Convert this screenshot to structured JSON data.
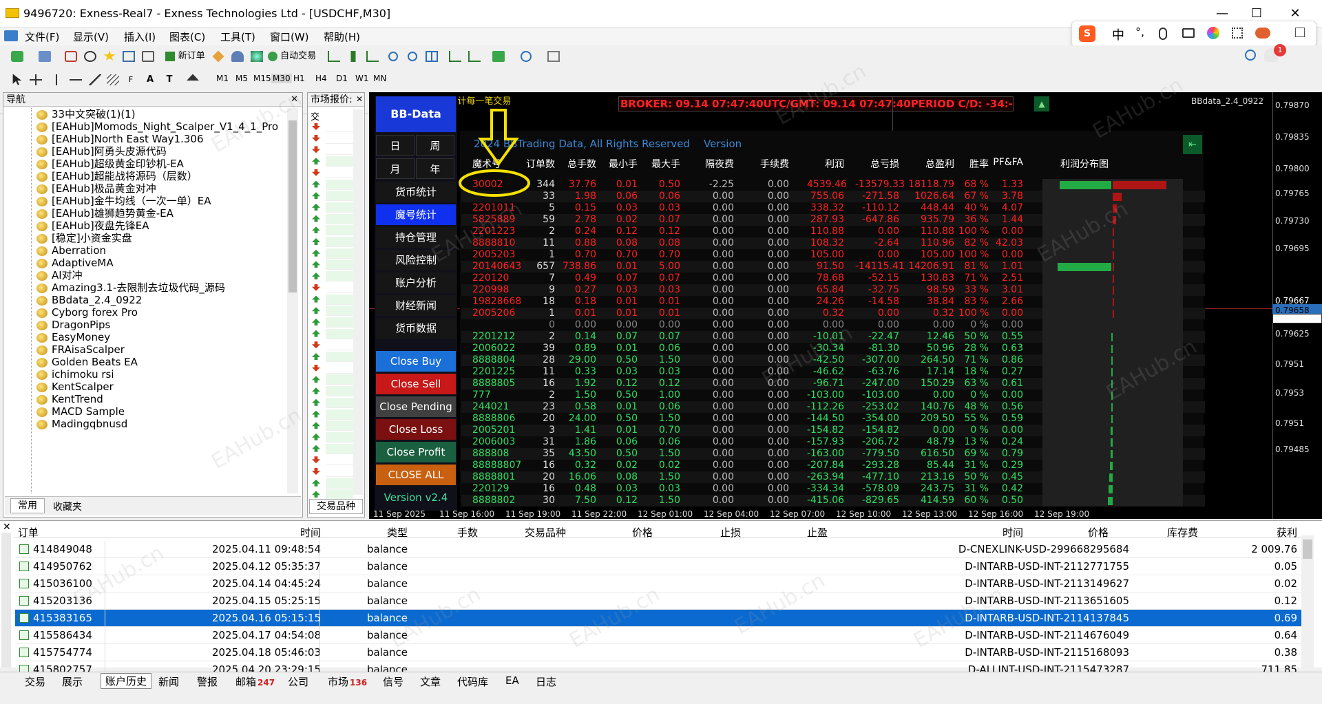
{
  "window": {
    "title": "9496720: Exness-Real7 - Exness Technologies Ltd - [USDCHF,M30]",
    "min": "—",
    "max": "☐",
    "close": "✕"
  },
  "menu": [
    "文件(F)",
    "显示(V)",
    "插入(I)",
    "图表(C)",
    "工具(T)",
    "窗口(W)",
    "帮助(H)"
  ],
  "ime": {
    "label_zh": "中",
    "punct": "°,"
  },
  "toolbar": {
    "new_order": "新订单",
    "auto_trade": "自动交易",
    "timeframes": [
      "M1",
      "M5",
      "M15",
      "M30",
      "H1",
      "H4",
      "D1",
      "W1",
      "MN"
    ]
  },
  "navigator": {
    "title": "导航",
    "items": [
      "33中文突破(1)(1)",
      "[EAHub]Momods_Night_Scalper_V1_4_1_Pro",
      "[EAHub]North East Way1.306",
      "[EAHub]阿勇头皮源代码",
      "[EAHub]超级黄金印钞机-EA",
      "[EAHub]超能战将源码（层数）",
      "[EAHub]极品黄金对冲",
      "[EAHub]金牛均线（一次一单）EA",
      "[EAHub]雄狮趋势黄金-EA",
      "[EAHub]夜盘先锋EA",
      "[稳定]小资金实盘",
      "Aberration",
      "AdaptiveMA",
      "AI对冲",
      "Amazing3.1-去限制去垃圾代码_源码",
      "BBdata_2.4_0922",
      "Cyborg forex  Pro",
      "DragonPips",
      "EasyMoney",
      "FRAisaScalper",
      "Golden Beats EA",
      "ichimoku rsi",
      "KentScalper",
      "KentTrend",
      "MACD Sample",
      "Madingqbnusd"
    ],
    "tab_common": "常用",
    "tab_fav": "收藏夹"
  },
  "market": {
    "title": "市场报价:",
    "col": "交",
    "tab": "交易品种"
  },
  "chart": {
    "symbol_label": "BBdata_2.4_0922",
    "annotation": "MT4统计每一笔交易",
    "ticker": "BROKER: 09.14 07:47:40UTC/GMT: 09.14 07:47:40PERIOD C/D: -34:-47:-40",
    "copyright": "2024 BBTrading Data, All Rights Reserved",
    "version_label": "Version",
    "prices": [
      "0.79870",
      "0.79835",
      "0.79800",
      "0.79765",
      "0.79730",
      "0.79695",
      "0.79667",
      "0.79658",
      "0.79625",
      "0.7951",
      "0.7953",
      "0.7951",
      "0.79485"
    ],
    "times": [
      "11 Sep 2025",
      "11 Sep 16:00",
      "11 Sep 19:00",
      "11 Sep 22:00",
      "12 Sep 01:00",
      "12 Sep 04:00",
      "12 Sep 07:00",
      "12 Sep 10:00",
      "12 Sep 13:00",
      "12 Sep 16:00",
      "12 Sep 19:00"
    ]
  },
  "bb": {
    "logo": "BB-Data",
    "day": "日",
    "week": "周",
    "month": "月",
    "year": "年",
    "currency": "货币统计",
    "magic": "魔号统计",
    "position": "持仓管理",
    "risk": "风险控制",
    "account": "账户分析",
    "news": "财经新闻",
    "data": "货币数据",
    "close_buy": "Close Buy",
    "close_sell": "Close Sell",
    "close_pending": "Close Pending",
    "close_loss": "Close Loss",
    "close_profit": "Close Profit",
    "close_all": "CLOSE ALL",
    "version": "Version v2.4"
  },
  "stats": {
    "headers": [
      "魔术号",
      "订单数",
      "总手数",
      "最小手",
      "最大手",
      "隔夜费",
      "手续费",
      "利润",
      "总亏损",
      "总盈利",
      "胜率",
      "PF&FA",
      "利润分布图"
    ],
    "rows": [
      [
        "30002",
        "344",
        "37.76",
        "0.01",
        "0.50",
        "-2.25",
        "0.00",
        "4539.46",
        "-13579.33",
        "18118.79",
        "68 %",
        "1.33",
        "r"
      ],
      [
        "",
        "33",
        "1.98",
        "0.06",
        "0.06",
        "0.00",
        "0.00",
        "755.06",
        "-271.58",
        "1026.64",
        "67 %",
        "3.78",
        "r"
      ],
      [
        "2201011",
        "5",
        "0.15",
        "0.03",
        "0.03",
        "0.00",
        "0.00",
        "338.32",
        "-110.12",
        "448.44",
        "40 %",
        "4.07",
        "r"
      ],
      [
        "5825889",
        "59",
        "2.78",
        "0.02",
        "0.07",
        "0.00",
        "0.00",
        "287.93",
        "-647.86",
        "935.79",
        "36 %",
        "1.44",
        "r"
      ],
      [
        "2201223",
        "2",
        "0.24",
        "0.12",
        "0.12",
        "0.00",
        "0.00",
        "110.88",
        "0.00",
        "110.88",
        "100 %",
        "0.00",
        "r"
      ],
      [
        "8888810",
        "11",
        "0.88",
        "0.08",
        "0.08",
        "0.00",
        "0.00",
        "108.32",
        "-2.64",
        "110.96",
        "82 %",
        "42.03",
        "r"
      ],
      [
        "2005203",
        "1",
        "0.70",
        "0.70",
        "0.70",
        "0.00",
        "0.00",
        "105.00",
        "0.00",
        "105.00",
        "100 %",
        "0.00",
        "r"
      ],
      [
        "20140643",
        "657",
        "738.86",
        "0.01",
        "5.00",
        "0.00",
        "0.00",
        "91.50",
        "-14115.41",
        "14206.91",
        "81 %",
        "1.01",
        "r"
      ],
      [
        "220120",
        "7",
        "0.49",
        "0.07",
        "0.07",
        "0.00",
        "0.00",
        "78.68",
        "-52.15",
        "130.83",
        "71 %",
        "2.51",
        "r"
      ],
      [
        "220998",
        "9",
        "0.27",
        "0.03",
        "0.03",
        "0.00",
        "0.00",
        "65.84",
        "-32.75",
        "98.59",
        "33 %",
        "3.01",
        "r"
      ],
      [
        "19828668",
        "18",
        "0.18",
        "0.01",
        "0.01",
        "0.00",
        "0.00",
        "24.26",
        "-14.58",
        "38.84",
        "83 %",
        "2.66",
        "r"
      ],
      [
        "2005206",
        "1",
        "0.01",
        "0.01",
        "0.01",
        "0.00",
        "0.00",
        "0.32",
        "0.00",
        "0.32",
        "100 %",
        "0.00",
        "r"
      ],
      [
        "",
        "0",
        "0.00",
        "0.00",
        "0.00",
        "0.00",
        "0.00",
        "0.00",
        "0.00",
        "0.00",
        "0 %",
        "0.00",
        "w"
      ],
      [
        "2201212",
        "2",
        "0.14",
        "0.07",
        "0.07",
        "0.00",
        "0.00",
        "-10.01",
        "-22.47",
        "12.46",
        "50 %",
        "0.55",
        "g"
      ],
      [
        "2006022",
        "39",
        "0.89",
        "0.01",
        "0.06",
        "0.00",
        "0.00",
        "-30.34",
        "-81.30",
        "50.96",
        "28 %",
        "0.63",
        "g"
      ],
      [
        "8888804",
        "28",
        "29.00",
        "0.50",
        "1.50",
        "0.00",
        "0.00",
        "-42.50",
        "-307.00",
        "264.50",
        "71 %",
        "0.86",
        "g"
      ],
      [
        "2201225",
        "11",
        "0.33",
        "0.03",
        "0.03",
        "0.00",
        "0.00",
        "-46.62",
        "-63.76",
        "17.14",
        "18 %",
        "0.27",
        "g"
      ],
      [
        "8888805",
        "16",
        "1.92",
        "0.12",
        "0.12",
        "0.00",
        "0.00",
        "-96.71",
        "-247.00",
        "150.29",
        "63 %",
        "0.61",
        "g"
      ],
      [
        "777",
        "2",
        "1.50",
        "0.50",
        "1.00",
        "0.00",
        "0.00",
        "-103.00",
        "-103.00",
        "0.00",
        "0 %",
        "0.00",
        "g"
      ],
      [
        "244021",
        "23",
        "0.58",
        "0.01",
        "0.06",
        "0.00",
        "0.00",
        "-112.26",
        "-253.02",
        "140.76",
        "48 %",
        "0.56",
        "g"
      ],
      [
        "8888806",
        "20",
        "24.00",
        "0.50",
        "1.50",
        "0.00",
        "0.00",
        "-144.50",
        "-354.00",
        "209.50",
        "55 %",
        "0.59",
        "g"
      ],
      [
        "2005201",
        "3",
        "1.41",
        "0.01",
        "0.70",
        "0.00",
        "0.00",
        "-154.82",
        "-154.82",
        "0.00",
        "0 %",
        "0.00",
        "g"
      ],
      [
        "2006003",
        "31",
        "1.86",
        "0.06",
        "0.06",
        "0.00",
        "0.00",
        "-157.93",
        "-206.72",
        "48.79",
        "13 %",
        "0.24",
        "g"
      ],
      [
        "888808",
        "35",
        "43.50",
        "0.50",
        "1.50",
        "0.00",
        "0.00",
        "-163.00",
        "-779.50",
        "616.50",
        "69 %",
        "0.79",
        "g"
      ],
      [
        "88888807",
        "16",
        "0.32",
        "0.02",
        "0.02",
        "0.00",
        "0.00",
        "-207.84",
        "-293.28",
        "85.44",
        "31 %",
        "0.29",
        "g"
      ],
      [
        "8888801",
        "20",
        "16.06",
        "0.08",
        "1.50",
        "0.00",
        "0.00",
        "-263.94",
        "-477.10",
        "213.16",
        "50 %",
        "0.45",
        "g"
      ],
      [
        "220129",
        "16",
        "0.48",
        "0.03",
        "0.03",
        "0.00",
        "0.00",
        "-334.34",
        "-578.09",
        "243.75",
        "31 %",
        "0.42",
        "g"
      ],
      [
        "8888802",
        "30",
        "7.50",
        "0.12",
        "1.50",
        "0.00",
        "0.00",
        "-415.06",
        "-829.65",
        "414.59",
        "60 %",
        "0.50",
        "g"
      ]
    ]
  },
  "terminal": {
    "headers": [
      "订单",
      "时间",
      "类型",
      "手数",
      "交易品种",
      "价格",
      "止损",
      "止盈",
      "时间",
      "价格",
      "库存费",
      "获利"
    ],
    "rows": [
      [
        "414849048",
        "2025.04.11 09:48:54",
        "balance",
        "D-CNEXLINK-USD-299668295684",
        "2 009.76"
      ],
      [
        "414950762",
        "2025.04.12 05:35:37",
        "balance",
        "D-INTARB-USD-INT-2112771755",
        "0.05"
      ],
      [
        "415036100",
        "2025.04.14 04:45:24",
        "balance",
        "D-INTARB-USD-INT-2113149627",
        "0.02"
      ],
      [
        "415203136",
        "2025.04.15 05:25:15",
        "balance",
        "D-INTARB-USD-INT-2113651605",
        "0.12"
      ],
      [
        "415383165",
        "2025.04.16 05:15:15",
        "balance",
        "D-INTARB-USD-INT-2114137845",
        "0.69"
      ],
      [
        "415586434",
        "2025.04.17 04:54:08",
        "balance",
        "D-INTARB-USD-INT-2114676049",
        "0.64"
      ],
      [
        "415754774",
        "2025.04.18 05:46:03",
        "balance",
        "D-INTARB-USD-INT-2115168093",
        "0.38"
      ],
      [
        "415802757",
        "2025.04.20 23:29:15",
        "balance",
        "D-ALLINT-USD-INT-2115473287",
        "711.85"
      ]
    ],
    "tabs": [
      "交易",
      "展示",
      "账户历史",
      "新闻",
      "警报",
      "邮箱",
      "公司",
      "市场",
      "信号",
      "文章",
      "代码库",
      "EA",
      "日志"
    ],
    "mail_count": "247",
    "market_count": "136"
  },
  "watermark": "EAHub.cn"
}
